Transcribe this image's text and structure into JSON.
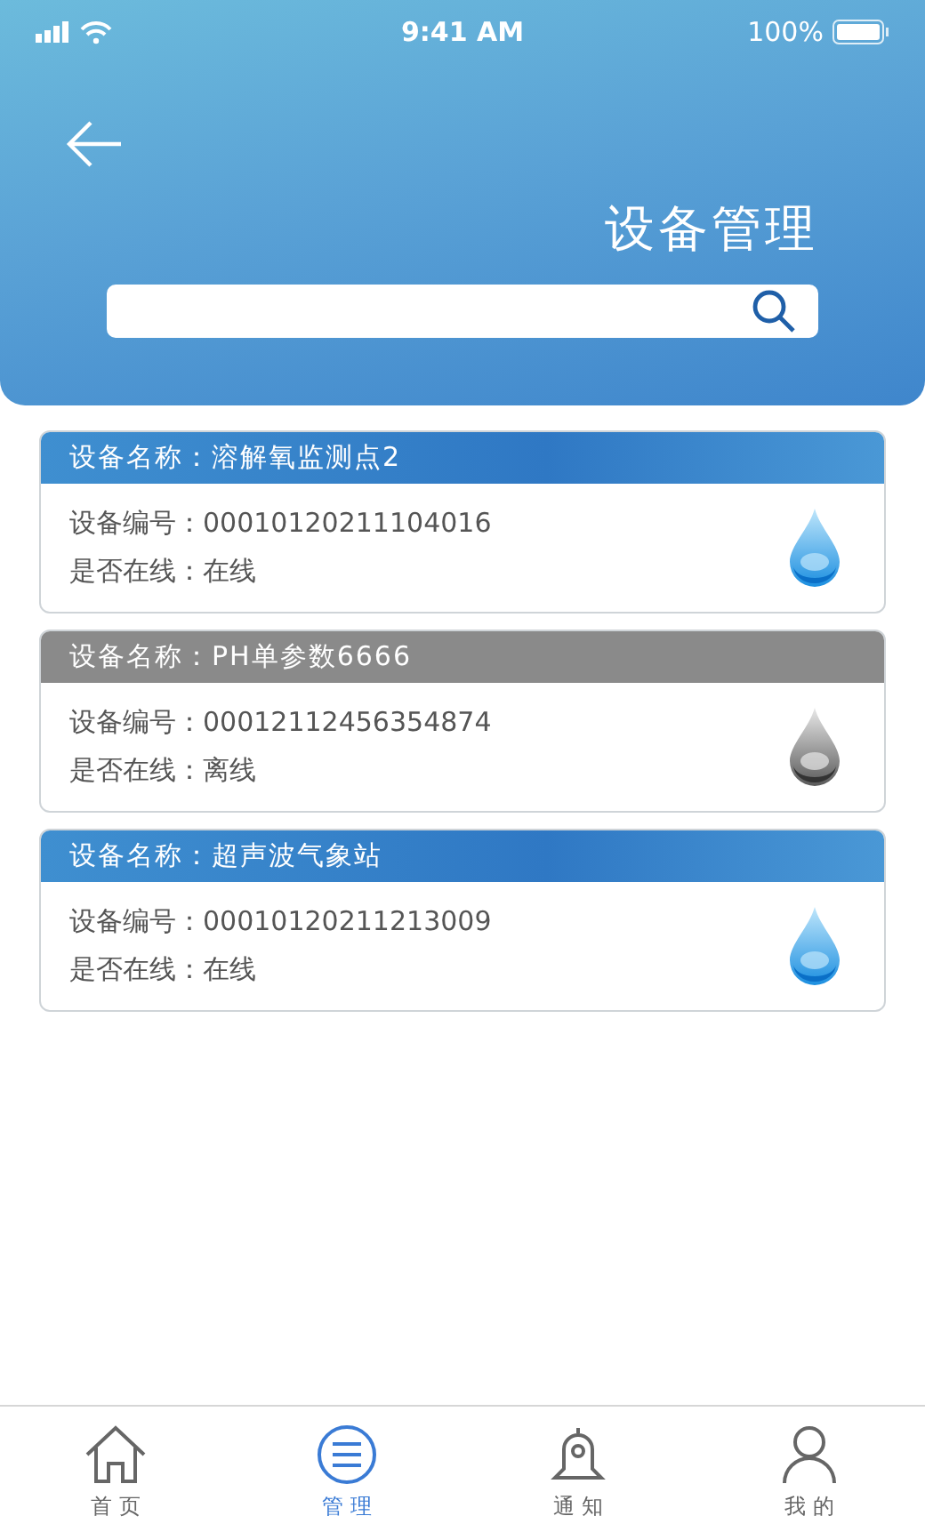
{
  "status_bar": {
    "time": "9:41 AM",
    "battery": "100%"
  },
  "header": {
    "title": "设备管理"
  },
  "devices": [
    {
      "name": "设备名称：溶解氧监测点2",
      "number": "设备编号：00010120211104016",
      "status": "是否在线：在线",
      "online": true
    },
    {
      "name": "设备名称：PH单参数6666",
      "number": "设备编号：00012112456354874",
      "status": "是否在线：离线",
      "online": false
    },
    {
      "name": "设备名称：超声波气象站",
      "number": "设备编号：00010120211213009",
      "status": "是否在线：在线",
      "online": true
    }
  ],
  "tab_bar": [
    {
      "label": "首 页",
      "selected": false
    },
    {
      "label": "管 理",
      "selected": true
    },
    {
      "label": "通 知",
      "selected": false
    },
    {
      "label": "我 的",
      "selected": false
    }
  ]
}
